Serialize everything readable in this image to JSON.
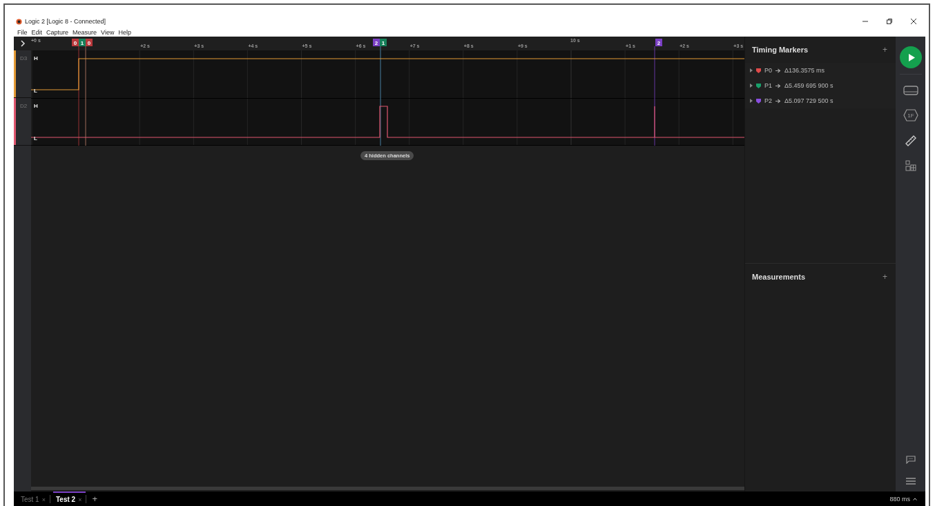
{
  "window": {
    "title": "Logic 2 [Logic 8 - Connected]"
  },
  "menu": [
    "File",
    "Edit",
    "Capture",
    "Measure",
    "View",
    "Help"
  ],
  "ruler": {
    "ticks": [
      {
        "label": "+0 s",
        "kind": "major"
      },
      {
        "label": "+2 s",
        "kind": "minor"
      },
      {
        "label": "+3 s",
        "kind": "minor"
      },
      {
        "label": "+4 s",
        "kind": "minor"
      },
      {
        "label": "+5 s",
        "kind": "minor"
      },
      {
        "label": "+6 s",
        "kind": "minor"
      },
      {
        "label": "+7 s",
        "kind": "minor"
      },
      {
        "label": "+8 s",
        "kind": "minor"
      },
      {
        "label": "+9 s",
        "kind": "minor"
      },
      {
        "label": "10 s",
        "kind": "major"
      },
      {
        "label": "+1 s",
        "kind": "minor"
      },
      {
        "label": "+2 s",
        "kind": "minor"
      },
      {
        "label": "+3 s",
        "kind": "minor"
      }
    ]
  },
  "markers": [
    {
      "label": "0",
      "color": "#b8383b"
    },
    {
      "label": "1",
      "color": "#16805a"
    },
    {
      "label": "0",
      "color": "#b8383b"
    },
    {
      "label": "2",
      "color": "#7a3fc4"
    },
    {
      "label": "1",
      "color": "#16805a"
    },
    {
      "label": "2",
      "color": "#7a3fc4"
    }
  ],
  "channels": [
    {
      "name": "D3",
      "color": "#e39a35",
      "high_label": "H",
      "low_label": "L"
    },
    {
      "name": "D2",
      "color": "#e0566f",
      "high_label": "H",
      "low_label": "L"
    }
  ],
  "hidden_channels": "4 hidden channels",
  "timing_markers": {
    "title": "Timing Markers",
    "add": "+",
    "items": [
      {
        "name": "P0",
        "color": "#e04a4a",
        "delta": "Δ136.3575 ms"
      },
      {
        "name": "P1",
        "color": "#18a06a",
        "delta": "Δ5.459 695 900 s"
      },
      {
        "name": "P2",
        "color": "#8a4ee0",
        "delta": "Δ5.097 729 500 s"
      }
    ]
  },
  "measurements": {
    "title": "Measurements",
    "add": "+"
  },
  "rail": {
    "chip_label": "1F"
  },
  "tabs": [
    {
      "label": "Test 1",
      "close": "×",
      "selected": false
    },
    {
      "label": "Test 2",
      "close": "×",
      "selected": true
    }
  ],
  "new_tab": "+",
  "status": "880 ms"
}
